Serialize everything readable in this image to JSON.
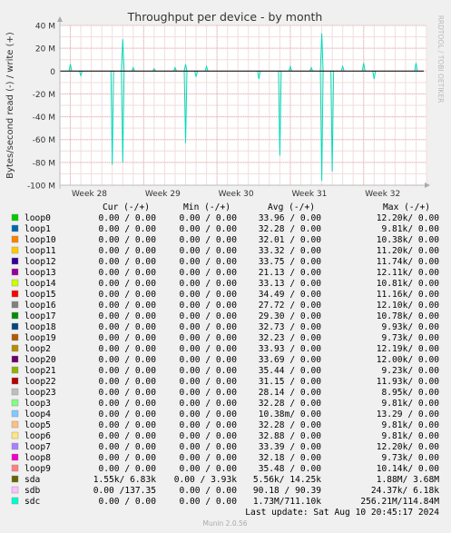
{
  "chart_data": {
    "type": "line",
    "title": "Throughput per device - by month",
    "ylabel": "Bytes/second read (-) / write (+)",
    "side_label": "RRDTOOL / TOBI OETIKER",
    "ylim": [
      -100000000,
      40000000
    ],
    "y_ticks": [
      {
        "value": 40000000,
        "label": "40 M"
      },
      {
        "value": 20000000,
        "label": "20 M"
      },
      {
        "value": 0,
        "label": "0"
      },
      {
        "value": -20000000,
        "label": "-20 M"
      },
      {
        "value": -40000000,
        "label": "-40 M"
      },
      {
        "value": -60000000,
        "label": "-60 M"
      },
      {
        "value": -80000000,
        "label": "-80 M"
      },
      {
        "value": -100000000,
        "label": "-100 M"
      }
    ],
    "xlim": [
      "2024-07-07",
      "2024-08-11"
    ],
    "x_ticks": [
      {
        "date": "2024-07-08",
        "label": "Week 28"
      },
      {
        "date": "2024-07-15",
        "label": "Week 29"
      },
      {
        "date": "2024-07-22",
        "label": "Week 30"
      },
      {
        "date": "2024-07-29",
        "label": "Week 31"
      },
      {
        "date": "2024-08-05",
        "label": "Week 32"
      }
    ],
    "grid": true,
    "spike_color": "#00ddb8",
    "write_spikes": [
      {
        "date": "2024-07-08",
        "value": 6000000
      },
      {
        "date": "2024-07-09",
        "value": -4000000
      },
      {
        "date": "2024-07-13",
        "value": 28000000
      },
      {
        "date": "2024-07-14",
        "value": 3000000
      },
      {
        "date": "2024-07-16",
        "value": 2000000
      },
      {
        "date": "2024-07-18",
        "value": 3000000
      },
      {
        "date": "2024-07-19",
        "value": 6000000
      },
      {
        "date": "2024-07-21",
        "value": 4000000
      },
      {
        "date": "2024-07-29",
        "value": 4000000
      },
      {
        "date": "2024-07-31",
        "value": 3000000
      },
      {
        "date": "2024-08-01",
        "value": 33000000
      },
      {
        "date": "2024-08-03",
        "value": 4000000
      },
      {
        "date": "2024-08-05",
        "value": 7000000
      },
      {
        "date": "2024-08-06",
        "value": -7000000
      },
      {
        "date": "2024-08-10",
        "value": 7000000
      }
    ],
    "read_spikes": [
      {
        "date": "2024-07-12",
        "value": -82000000
      },
      {
        "date": "2024-07-13",
        "value": -80000000
      },
      {
        "date": "2024-07-19",
        "value": -63000000
      },
      {
        "date": "2024-07-20",
        "value": -5000000
      },
      {
        "date": "2024-07-26",
        "value": -7000000
      },
      {
        "date": "2024-07-28",
        "value": -74000000
      },
      {
        "date": "2024-08-01",
        "value": -96000000
      },
      {
        "date": "2024-08-02",
        "value": -88000000
      }
    ]
  },
  "columns": [
    "Cur (-/+)",
    "Min (-/+)",
    "Avg (-/+)",
    "Max (-/+)"
  ],
  "legend": [
    {
      "name": "loop0",
      "color": "#00cc00",
      "cur": "0.00 /  0.00",
      "min": "0.00 /  0.00",
      "avg": "33.96 /  0.00",
      "max": "12.20k/  0.00"
    },
    {
      "name": "loop1",
      "color": "#0066b3",
      "cur": "0.00 /  0.00",
      "min": "0.00 /  0.00",
      "avg": "32.28 /  0.00",
      "max": "9.81k/  0.00"
    },
    {
      "name": "loop10",
      "color": "#ff8000",
      "cur": "0.00 /  0.00",
      "min": "0.00 /  0.00",
      "avg": "32.01 /  0.00",
      "max": "10.38k/  0.00"
    },
    {
      "name": "loop11",
      "color": "#ffcc00",
      "cur": "0.00 /  0.00",
      "min": "0.00 /  0.00",
      "avg": "33.32 /  0.00",
      "max": "11.20k/  0.00"
    },
    {
      "name": "loop12",
      "color": "#330099",
      "cur": "0.00 /  0.00",
      "min": "0.00 /  0.00",
      "avg": "33.75 /  0.00",
      "max": "11.74k/  0.00"
    },
    {
      "name": "loop13",
      "color": "#990099",
      "cur": "0.00 /  0.00",
      "min": "0.00 /  0.00",
      "avg": "21.13 /  0.00",
      "max": "12.11k/  0.00"
    },
    {
      "name": "loop14",
      "color": "#ccff00",
      "cur": "0.00 /  0.00",
      "min": "0.00 /  0.00",
      "avg": "33.13 /  0.00",
      "max": "10.81k/  0.00"
    },
    {
      "name": "loop15",
      "color": "#ff0000",
      "cur": "0.00 /  0.00",
      "min": "0.00 /  0.00",
      "avg": "34.49 /  0.00",
      "max": "11.16k/  0.00"
    },
    {
      "name": "loop16",
      "color": "#808080",
      "cur": "0.00 /  0.00",
      "min": "0.00 /  0.00",
      "avg": "27.72 /  0.00",
      "max": "12.10k/  0.00"
    },
    {
      "name": "loop17",
      "color": "#008f00",
      "cur": "0.00 /  0.00",
      "min": "0.00 /  0.00",
      "avg": "29.30 /  0.00",
      "max": "10.78k/  0.00"
    },
    {
      "name": "loop18",
      "color": "#00487d",
      "cur": "0.00 /  0.00",
      "min": "0.00 /  0.00",
      "avg": "32.73 /  0.00",
      "max": "9.93k/  0.00"
    },
    {
      "name": "loop19",
      "color": "#b35a00",
      "cur": "0.00 /  0.00",
      "min": "0.00 /  0.00",
      "avg": "32.23 /  0.00",
      "max": "9.73k/  0.00"
    },
    {
      "name": "loop2",
      "color": "#b38f00",
      "cur": "0.00 /  0.00",
      "min": "0.00 /  0.00",
      "avg": "33.93 /  0.00",
      "max": "12.19k/  0.00"
    },
    {
      "name": "loop20",
      "color": "#6b006b",
      "cur": "0.00 /  0.00",
      "min": "0.00 /  0.00",
      "avg": "33.69 /  0.00",
      "max": "12.00k/  0.00"
    },
    {
      "name": "loop21",
      "color": "#8fb300",
      "cur": "0.00 /  0.00",
      "min": "0.00 /  0.00",
      "avg": "35.44 /  0.00",
      "max": "9.23k/  0.00"
    },
    {
      "name": "loop22",
      "color": "#b30000",
      "cur": "0.00 /  0.00",
      "min": "0.00 /  0.00",
      "avg": "31.15 /  0.00",
      "max": "11.93k/  0.00"
    },
    {
      "name": "loop23",
      "color": "#bebebe",
      "cur": "0.00 /  0.00",
      "min": "0.00 /  0.00",
      "avg": "28.14 /  0.00",
      "max": "8.95k/  0.00"
    },
    {
      "name": "loop3",
      "color": "#80ff80",
      "cur": "0.00 /  0.00",
      "min": "0.00 /  0.00",
      "avg": "32.28 /  0.00",
      "max": "9.81k/  0.00"
    },
    {
      "name": "loop4",
      "color": "#80c9ff",
      "cur": "0.00 /  0.00",
      "min": "0.00 /  0.00",
      "avg": "10.38m/  0.00",
      "max": "13.29 /  0.00"
    },
    {
      "name": "loop5",
      "color": "#ffc080",
      "cur": "0.00 /  0.00",
      "min": "0.00 /  0.00",
      "avg": "32.28 /  0.00",
      "max": "9.81k/  0.00"
    },
    {
      "name": "loop6",
      "color": "#ffe680",
      "cur": "0.00 /  0.00",
      "min": "0.00 /  0.00",
      "avg": "32.88 /  0.00",
      "max": "9.81k/  0.00"
    },
    {
      "name": "loop7",
      "color": "#aa80ff",
      "cur": "0.00 /  0.00",
      "min": "0.00 /  0.00",
      "avg": "33.39 /  0.00",
      "max": "12.20k/  0.00"
    },
    {
      "name": "loop8",
      "color": "#ee00cc",
      "cur": "0.00 /  0.00",
      "min": "0.00 /  0.00",
      "avg": "32.18 /  0.00",
      "max": "9.73k/  0.00"
    },
    {
      "name": "loop9",
      "color": "#ff8080",
      "cur": "0.00 /  0.00",
      "min": "0.00 /  0.00",
      "avg": "35.48 /  0.00",
      "max": "10.14k/  0.00"
    },
    {
      "name": "sda",
      "color": "#666600",
      "cur": "1.55k/  6.83k",
      "min": "0.00 /  3.93k",
      "avg": "5.56k/ 14.25k",
      "max": "1.88M/  3.68M"
    },
    {
      "name": "sdb",
      "color": "#ffbfff",
      "cur": "0.00 /137.35",
      "min": "0.00 /  0.00",
      "avg": "90.18 / 90.39",
      "max": "24.37k/  6.18k"
    },
    {
      "name": "sdc",
      "color": "#00ffcc",
      "cur": "0.00 /  0.00",
      "min": "0.00 /  0.00",
      "avg": "1.73M/711.10k",
      "max": "256.21M/114.84M"
    }
  ],
  "last_update": "Last update: Sat Aug 10 20:45:17 2024",
  "footer": "Munin 2.0.56"
}
